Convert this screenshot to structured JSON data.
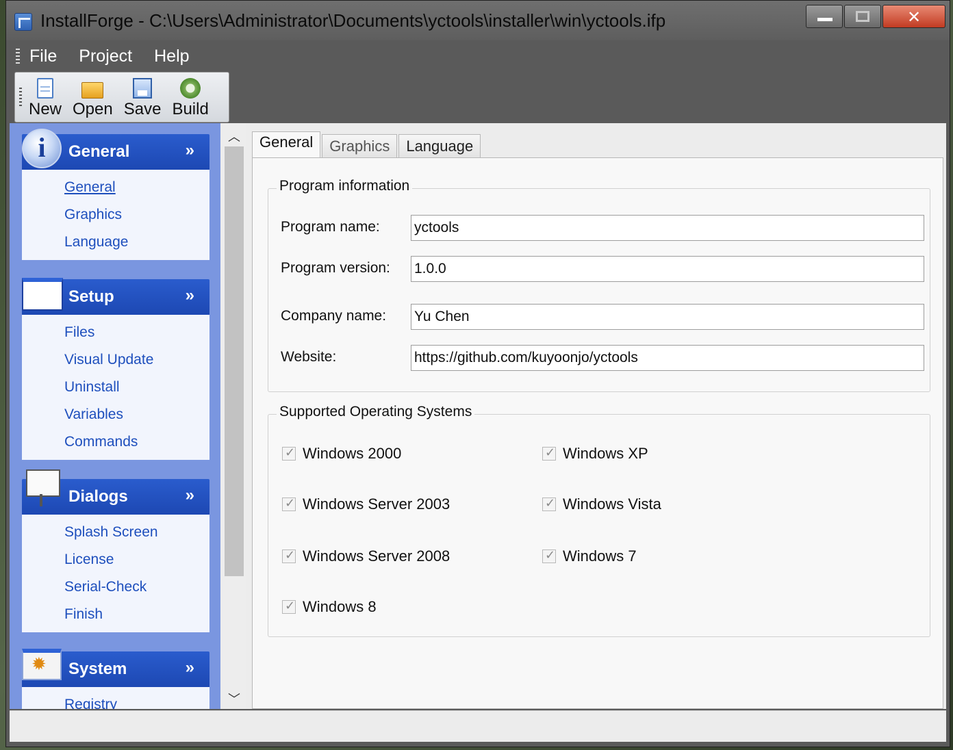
{
  "window": {
    "title": "InstallForge - C:\\Users\\Administrator\\Documents\\yctools\\installer\\win\\yctools.ifp"
  },
  "menu": [
    "File",
    "Project",
    "Help"
  ],
  "toolbar": {
    "new_label": "New",
    "open_label": "Open",
    "save_label": "Save",
    "build_label": "Build"
  },
  "sidebar": {
    "groups": [
      {
        "title": "General",
        "items": [
          "General",
          "Graphics",
          "Language"
        ]
      },
      {
        "title": "Setup",
        "items": [
          "Files",
          "Visual Update",
          "Uninstall",
          "Variables",
          "Commands"
        ]
      },
      {
        "title": "Dialogs",
        "items": [
          "Splash Screen",
          "License",
          "Serial-Check",
          "Finish"
        ]
      },
      {
        "title": "System",
        "items": [
          "Registry"
        ]
      }
    ]
  },
  "tabs": [
    "General",
    "Graphics",
    "Language"
  ],
  "program_info": {
    "legend": "Program information",
    "program_name_label": "Program name:",
    "program_name": "yctools",
    "program_version_label": "Program version:",
    "program_version": "1.0.0",
    "company_name_label": "Company name:",
    "company_name": "Yu Chen",
    "website_label": "Website:",
    "website": "https://github.com/kuyoonjo/yctools"
  },
  "supported_os": {
    "legend": "Supported Operating Systems",
    "items": [
      {
        "label": "Windows 2000",
        "checked": true
      },
      {
        "label": "Windows XP",
        "checked": true
      },
      {
        "label": "Windows Server 2003",
        "checked": true
      },
      {
        "label": "Windows Vista",
        "checked": true
      },
      {
        "label": "Windows Server 2008",
        "checked": true
      },
      {
        "label": "Windows 7",
        "checked": true
      },
      {
        "label": "Windows 8",
        "checked": true
      }
    ]
  }
}
